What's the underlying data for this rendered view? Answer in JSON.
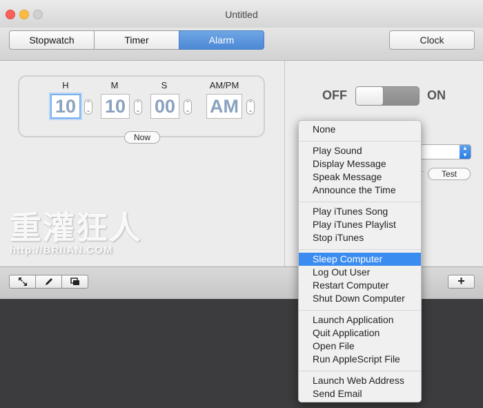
{
  "window": {
    "title": "Untitled"
  },
  "tabs": [
    "Stopwatch",
    "Timer",
    "Alarm"
  ],
  "active_tab": "Alarm",
  "clock_button": "Clock",
  "alarm": {
    "labels": {
      "h": "H",
      "m": "M",
      "s": "S",
      "ampm": "AM/PM"
    },
    "values": {
      "h": "10",
      "m": "10",
      "s": "00",
      "ampm": "AM"
    },
    "now_button": "Now"
  },
  "switch": {
    "off": "OFF",
    "on": "ON",
    "state": "off"
  },
  "test_button": "Test",
  "watermark": {
    "text": "重灌狂人",
    "url": "http://BRIIAN.COM"
  },
  "menu": {
    "items": [
      "None",
      "Play Sound",
      "Display Message",
      "Speak Message",
      "Announce the Time",
      "Play iTunes Song",
      "Play iTunes Playlist",
      "Stop iTunes",
      "Sleep Computer",
      "Log Out User",
      "Restart Computer",
      "Shut Down Computer",
      "Launch Application",
      "Quit Application",
      "Open File",
      "Run AppleScript File",
      "Launch Web Address",
      "Send Email"
    ],
    "highlighted": "Sleep Computer"
  },
  "colors": {
    "accent": "#3b8cf0",
    "tab_active": "#5b95dc"
  },
  "icons": [
    "resize-icon",
    "pencil-icon",
    "window-icon",
    "plus-icon",
    "stepper-icon",
    "popup-arrow-icon"
  ]
}
